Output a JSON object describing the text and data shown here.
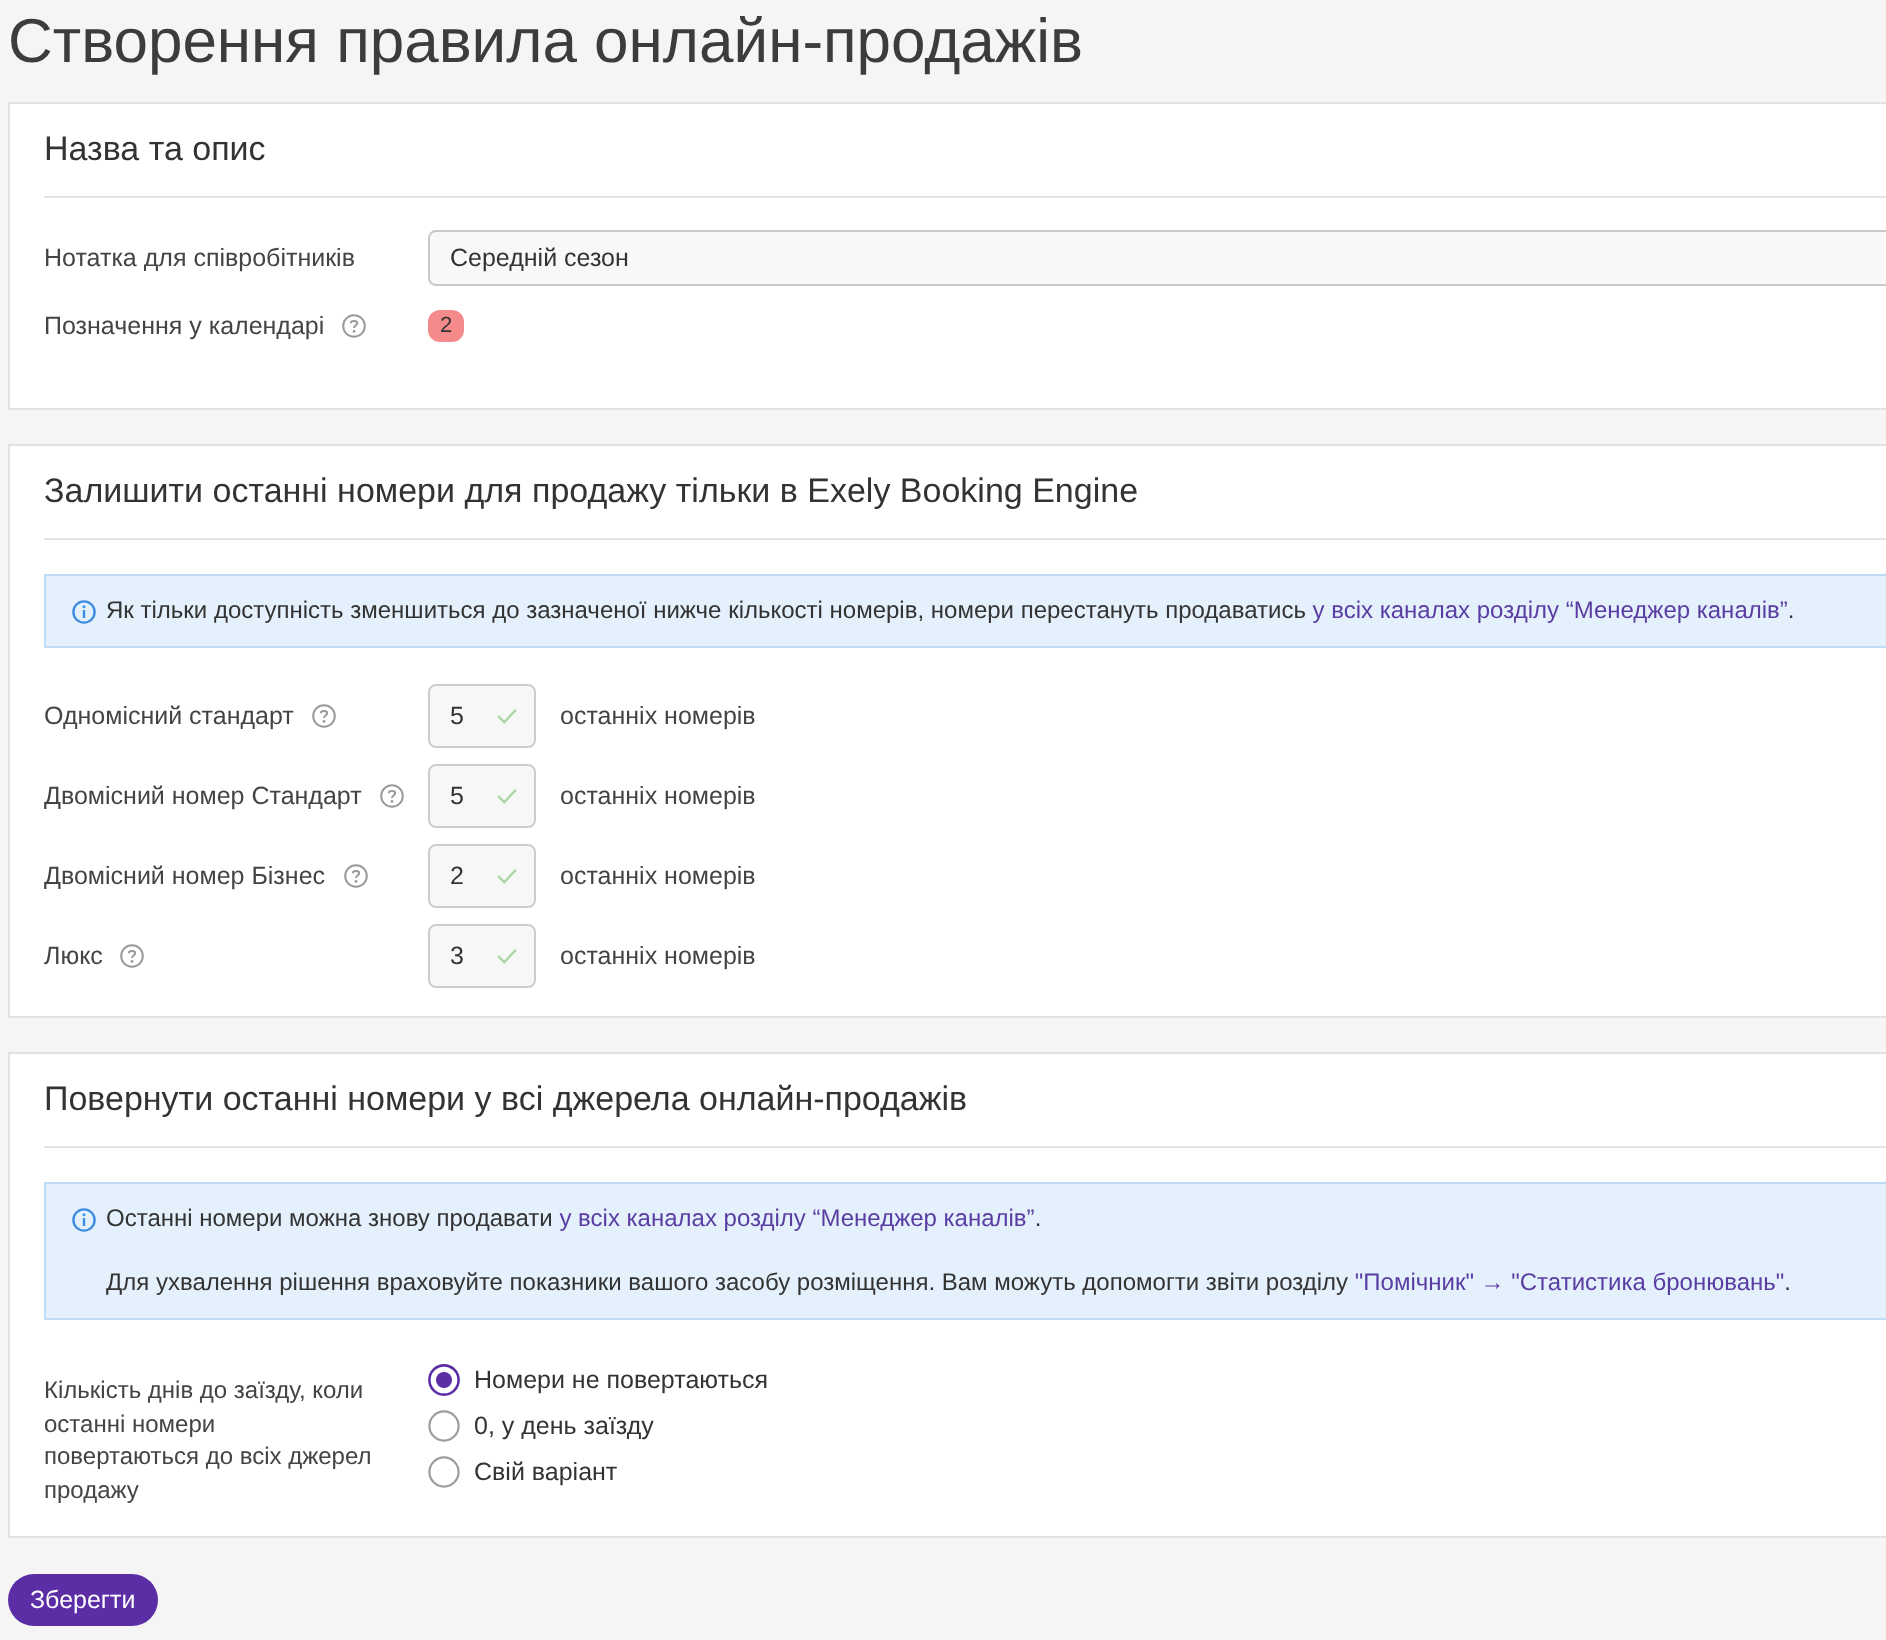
{
  "page_title": "Створення правила онлайн-продажів",
  "name_section": {
    "title": "Назва та опис",
    "fields": [
      {
        "kind": "text",
        "label": "Нотатка для співробітників",
        "help": false,
        "value": "Середній сезон"
      },
      {
        "kind": "badge",
        "label": "Позначення у календарі",
        "help": true,
        "value": "2"
      }
    ]
  },
  "limit_section": {
    "title": "Залишити останні номери для продажу тільки в Exely Booking Engine",
    "info": [
      {
        "text": "Як тільки доступність зменшиться до зазначеної нижче кількості номерів, номери перестануть продаватись ",
        "link": "у всіх каналах розділу “Менеджер каналів”",
        "after": "."
      }
    ],
    "rooms": [
      {
        "label": "Одномісний стандарт",
        "help": true,
        "value": "5",
        "suffix": "останніх номерів"
      },
      {
        "label": "Двомісний номер Стандарт",
        "help": true,
        "value": "5",
        "suffix": "останніх номерів"
      },
      {
        "label": "Двомісний номер Бізнес",
        "help": true,
        "value": "2",
        "suffix": "останніх номерів"
      },
      {
        "label": "Люкс",
        "help": true,
        "value": "3",
        "suffix": "останніх номерів"
      }
    ]
  },
  "return_section": {
    "title": "Повернути останні номери у всі джерела онлайн-продажів",
    "info": [
      {
        "text": "Останні номери можна знову продавати ",
        "link": "у всіх каналах розділу “Менеджер каналів”",
        "after": "."
      },
      {
        "text": "Для ухвалення рішення враховуйте показники вашого засобу розміщення. Вам можуть допомогти звіти розділу ",
        "link": "\"Помічник\" → \"Статистика бронювань\"",
        "after": "."
      }
    ],
    "question": "Кількість днів до заїзду, коли останні номери повертаються до всіх джерел продажу",
    "options": [
      {
        "label": "Номери не повертаються",
        "selected": true
      },
      {
        "label": "0, у день заїзду",
        "selected": false
      },
      {
        "label": "Свій варіант",
        "selected": false
      }
    ]
  },
  "save_button": "Зберегти"
}
